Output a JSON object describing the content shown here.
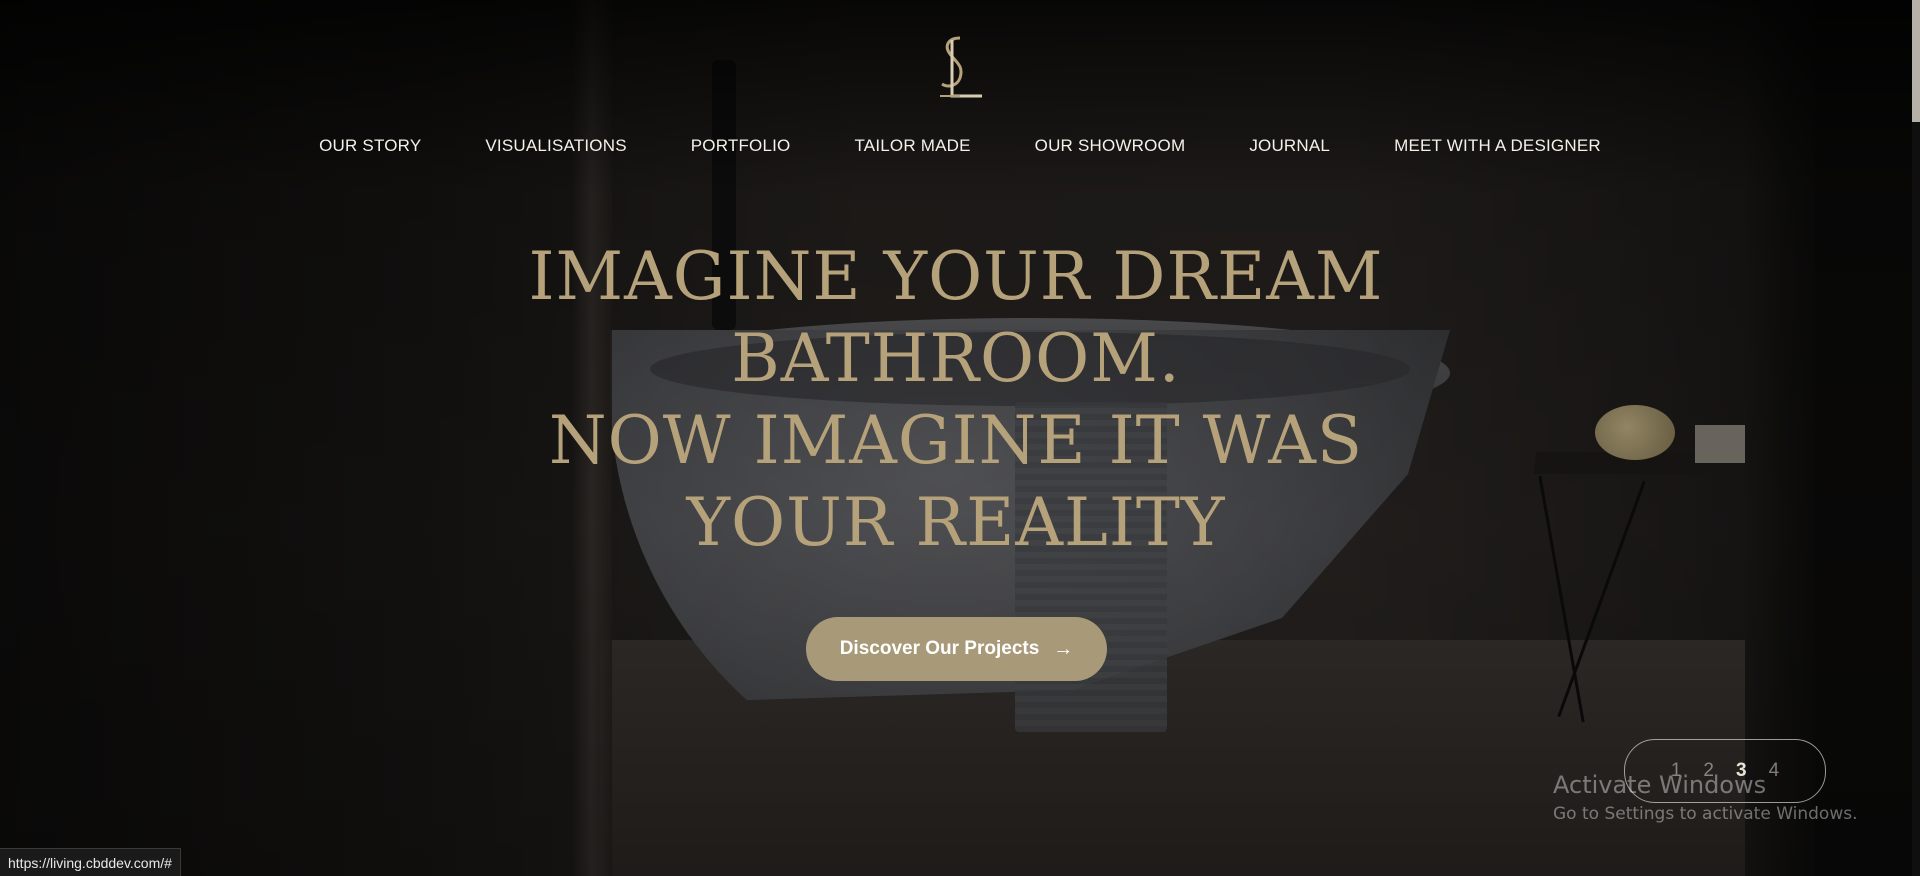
{
  "brand": {
    "logo_icon": "sl-monogram-icon"
  },
  "nav": {
    "items": [
      {
        "label": "OUR STORY"
      },
      {
        "label": "VISUALISATIONS"
      },
      {
        "label": "PORTFOLIO"
      },
      {
        "label": "TAILOR MADE"
      },
      {
        "label": "OUR SHOWROOM"
      },
      {
        "label": "JOURNAL"
      },
      {
        "label": "MEET WITH A DESIGNER"
      }
    ]
  },
  "hero": {
    "lines": [
      "IMAGINE YOUR DREAM",
      "BATHROOM.",
      "NOW IMAGINE IT WAS",
      "YOUR REALITY"
    ],
    "cta_label": "Discover Our Projects",
    "cta_icon": "arrow-right-icon"
  },
  "slider": {
    "pages": [
      "1",
      "2",
      "3",
      "4"
    ],
    "active_page": "3"
  },
  "windows_watermark": {
    "title": "Activate Windows",
    "subtitle": "Go to Settings to activate Windows."
  },
  "status_bar": {
    "url": "https://living.cbddev.com/#"
  },
  "colors": {
    "gold_text": "#b6a27a",
    "cta_bg": "#a89a78",
    "nav_text": "#f4f1ea"
  }
}
